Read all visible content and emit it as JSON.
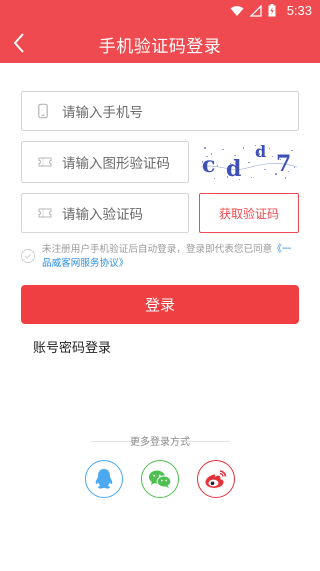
{
  "status_bar": {
    "time": "5:33"
  },
  "header": {
    "title": "手机验证码登录"
  },
  "form": {
    "phone_placeholder": "请输入手机号",
    "image_code_placeholder": "请输入图形验证码",
    "sms_code_placeholder": "请输入验证码",
    "captcha_chars": [
      "c",
      "d",
      "d",
      "7"
    ],
    "get_code_button": "获取验证码"
  },
  "agreement": {
    "text": "未注册用户手机验证后自动登录，登录即代表您已同意",
    "link": "《一品威客网服务协议》"
  },
  "login_button": "登录",
  "password_login_link": "账号密码登录",
  "more_login": {
    "label": "更多登录方式"
  },
  "colors": {
    "brand_red": "#ef4a4f",
    "qq_blue": "#4aa9f0",
    "wechat_green": "#4dc04f",
    "weibo_red": "#e0333a",
    "link_blue": "#2b8fe6"
  },
  "social": [
    {
      "name": "qq",
      "icon": "qq-icon"
    },
    {
      "name": "wechat",
      "icon": "wechat-icon"
    },
    {
      "name": "weibo",
      "icon": "weibo-icon"
    }
  ]
}
